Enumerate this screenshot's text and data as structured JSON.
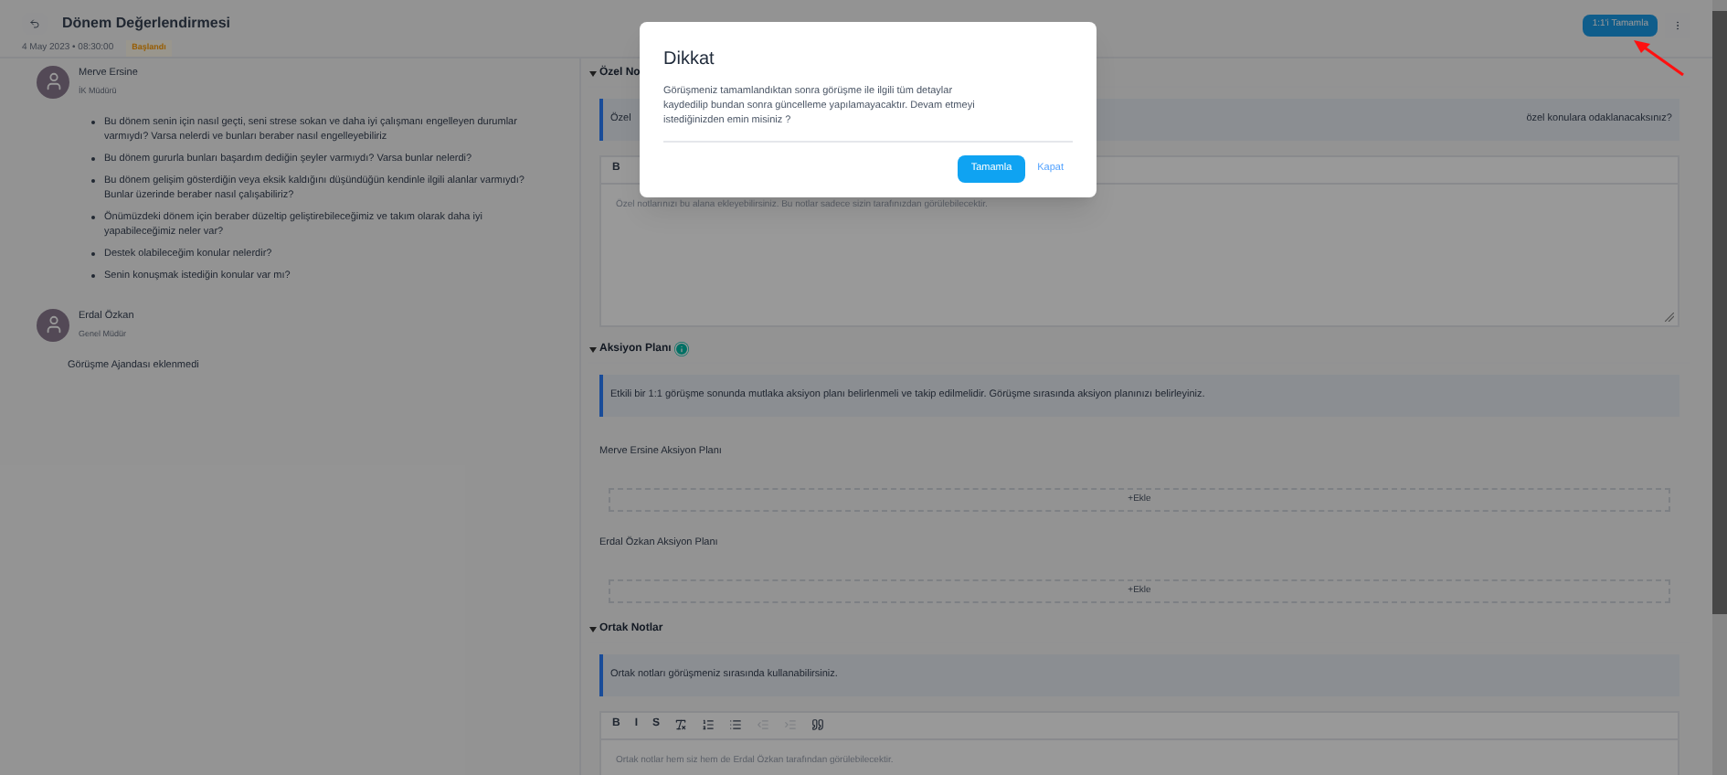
{
  "header": {
    "title": "Dönem Değerlendirmesi",
    "datetime": "4 May 2023 • 08:30:00",
    "status": "Başlandı",
    "complete_button": "1:1'i Tamamla"
  },
  "participants": [
    {
      "name": "Merve Ersine",
      "role": "İK Müdürü",
      "questions": [
        "Bu dönem senin için nasıl geçti, seni strese sokan ve daha iyi çalışmanı engelleyen durumlar varmıydı? Varsa nelerdi ve bunları beraber nasıl engelleyebiliriz",
        "Bu dönem gururla bunları başardım dediğin şeyler varmıydı? Varsa bunlar nelerdi?",
        "Bu dönem gelişim gösterdiğin veya eksik kaldığını düşündüğün kendinle ilgili alanlar varmıydı? Bunlar üzerinde beraber nasıl çalışabiliriz?",
        "Önümüzdeki dönem için beraber düzeltip geliştirebileceğimiz ve takım olarak daha iyi yapabileceğimiz neler var?",
        "Destek olabileceğim konular nelerdir?",
        "Senin konuşmak istediğin konular var mı?"
      ]
    },
    {
      "name": "Erdal Özkan",
      "role": "Genel Müdür",
      "empty_text": "Görüşme Ajandası eklenmedi"
    }
  ],
  "sections": [
    {
      "kind": "notes",
      "title": "Özel No",
      "expanded": true,
      "info_parts": [
        "Özel",
        "özel konulara odaklanacaksınız?"
      ],
      "toolbar": [
        {
          "kind": "text",
          "label": "B",
          "disabled": false
        }
      ],
      "placeholder": "Özel notlarınızı bu alana ekleyebilirsiniz. Bu notlar sadece sizin tarafınızdan görülebilecektir.",
      "tall": true
    },
    {
      "kind": "actions",
      "title": "Aksiyon Planı",
      "expanded": true,
      "info_parts": [
        "Etkili bir 1:1 görüşme sonunda mutlaka aksiyon planı belirlenmeli ve takip edilmelidir. Görüşme sırasında aksiyon planınızı belirleyiniz."
      ],
      "plans": [
        {
          "label": "Merve Ersine Aksiyon Planı",
          "add": "+Ekle"
        },
        {
          "label": "Erdal Özkan Aksiyon Planı",
          "add": "+Ekle"
        }
      ]
    },
    {
      "kind": "notes",
      "title": "Ortak Notlar",
      "expanded": true,
      "info_parts": [
        "Ortak notları görüşmeniz sırasında kullanabilirsiniz."
      ],
      "toolbar": [
        {
          "kind": "text",
          "label": "B",
          "disabled": false
        },
        {
          "kind": "text",
          "label": "I",
          "disabled": false
        },
        {
          "kind": "text",
          "label": "S",
          "disabled": false
        },
        {
          "kind": "clear-format",
          "disabled": false
        },
        {
          "kind": "ordered-list",
          "disabled": false
        },
        {
          "kind": "bullet-list",
          "disabled": false
        },
        {
          "kind": "outdent",
          "disabled": true
        },
        {
          "kind": "indent",
          "disabled": true
        },
        {
          "kind": "quote",
          "disabled": false
        }
      ],
      "placeholder": "Ortak notlar hem siz hem de Erdal Özkan tarafından görülebilecektir.",
      "tall": false
    }
  ],
  "dialog": {
    "title": "Dikkat",
    "message": "Görüşmeniz tamamlandıktan sonra görüşme ile ilgili tüm detaylar kaydedilip bundan sonra güncelleme yapılamayacaktır. Devam etmeyi istediğinizden emin misiniz ?",
    "confirm": "Tamamla",
    "cancel": "Kapat"
  }
}
